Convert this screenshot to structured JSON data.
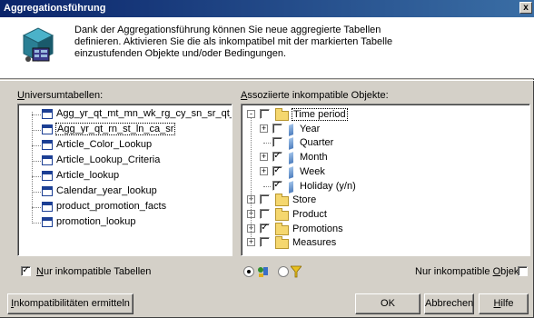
{
  "window": {
    "title": "Aggregationsführung",
    "close_label": "x"
  },
  "header": {
    "description": "Dank der Aggregationsführung können Sie neue aggregierte Tabellen definieren. Aktivieren Sie die als inkompatibel mit der markierten Tabelle einzustufenden Objekte und/oder Bedingungen."
  },
  "left_panel": {
    "label_accel": "U",
    "label_rest": "niversumtabellen:",
    "tables": [
      "Agg_yr_qt_mt_mn_wk_rg_cy_sn_sr_qt_ma",
      "Agg_yr_qt_rn_st_ln_ca_sr",
      "Article_Color_Lookup",
      "Article_Lookup_Criteria",
      "Article_lookup",
      "Calendar_year_lookup",
      "product_promotion_facts",
      "promotion_lookup"
    ],
    "selected_index": 1,
    "only_incompatible": {
      "accel": "N",
      "rest": "ur inkompatible Tabellen",
      "checked": true
    }
  },
  "right_panel": {
    "label_accel": "A",
    "label_rest": "ssoziierte inkompatible Objekte:",
    "tree": [
      {
        "label": "Time period",
        "type": "folder-open",
        "checked": false,
        "level": 0,
        "expander": "-"
      },
      {
        "label": "Year",
        "type": "dimension",
        "checked": false,
        "level": 1,
        "expander": "+"
      },
      {
        "label": "Quarter",
        "type": "dimension",
        "checked": false,
        "level": 1,
        "expander": ""
      },
      {
        "label": "Month",
        "type": "dimension",
        "checked": true,
        "level": 1,
        "expander": "+"
      },
      {
        "label": "Week",
        "type": "dimension",
        "checked": true,
        "level": 1,
        "expander": "+"
      },
      {
        "label": "Holiday (y/n)",
        "type": "dimension",
        "checked": true,
        "level": 1,
        "expander": ""
      },
      {
        "label": "Store",
        "type": "folder",
        "checked": false,
        "level": 0,
        "expander": "+"
      },
      {
        "label": "Product",
        "type": "folder",
        "checked": false,
        "level": 0,
        "expander": "+"
      },
      {
        "label": "Promotions",
        "type": "folder",
        "checked": true,
        "level": 0,
        "expander": "+"
      },
      {
        "label": "Measures",
        "type": "folder",
        "checked": false,
        "level": 0,
        "expander": "+"
      }
    ],
    "only_incompatible": {
      "pre": "Nur inkompatible ",
      "accel": "O",
      "post": "bjekte",
      "checked": false
    }
  },
  "view_toggle": {
    "objects_selected": true,
    "filter_selected": false
  },
  "buttons": {
    "detect_accel": "I",
    "detect_rest": "nkompatibilitäten ermitteln",
    "ok": "OK",
    "cancel": "Abbrechen",
    "help_accel": "H",
    "help_rest": "ilfe"
  },
  "colors": {
    "title_start": "#0a246a",
    "title_end": "#3a6ea5",
    "face": "#d4d0c8"
  }
}
